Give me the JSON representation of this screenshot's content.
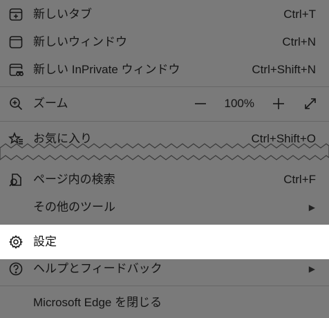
{
  "menu": {
    "new_tab": {
      "label": "新しいタブ",
      "shortcut": "Ctrl+T",
      "icon": "new-tab-icon"
    },
    "new_window": {
      "label": "新しいウィンドウ",
      "shortcut": "Ctrl+N",
      "icon": "window-icon"
    },
    "inprivate": {
      "label": "新しい InPrivate ウィンドウ",
      "shortcut": "Ctrl+Shift+N",
      "icon": "inprivate-window-icon"
    },
    "zoom": {
      "label": "ズーム",
      "minus": "—",
      "value": "100%",
      "plus": "+",
      "icon": "zoom-icon"
    },
    "favorites": {
      "label": "お気に入り",
      "shortcut": "Ctrl+Shift+O",
      "icon": "favorites-icon"
    },
    "find": {
      "label": "ページ内の検索",
      "shortcut": "Ctrl+F",
      "icon": "find-icon"
    },
    "more_tools": {
      "label": "その他のツール",
      "chevron": "▶"
    },
    "settings": {
      "label": "設定",
      "icon": "gear-icon"
    },
    "help": {
      "label": "ヘルプとフィードバック",
      "chevron": "▶",
      "icon": "help-icon"
    },
    "close": {
      "label": "Microsoft Edge を閉じる"
    }
  },
  "colors": {
    "overlay": "#7a7a7a",
    "highlight": "#ffffff",
    "text": "#141414"
  }
}
